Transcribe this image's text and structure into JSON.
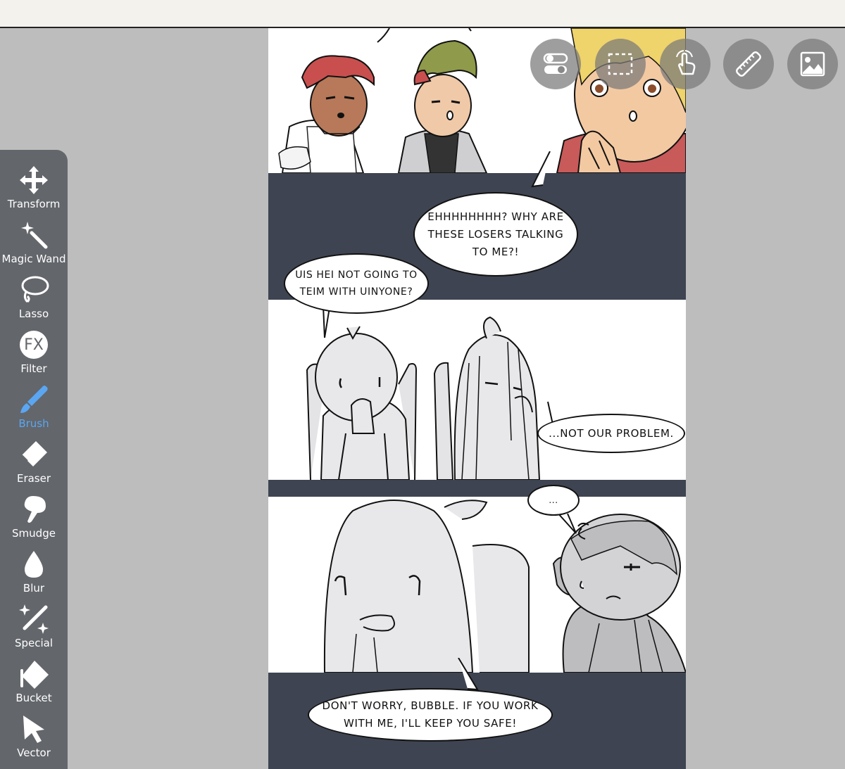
{
  "toolbar": {
    "tools": [
      {
        "label": "Transform",
        "icon": "move-arrows-icon"
      },
      {
        "label": "Magic Wand",
        "icon": "magic-wand-icon"
      },
      {
        "label": "Lasso",
        "icon": "lasso-icon"
      },
      {
        "label": "Filter",
        "icon": "fx-icon"
      },
      {
        "label": "Brush",
        "icon": "brush-icon",
        "active": true
      },
      {
        "label": "Eraser",
        "icon": "eraser-icon"
      },
      {
        "label": "Smudge",
        "icon": "smudge-icon"
      },
      {
        "label": "Blur",
        "icon": "blur-drop-icon"
      },
      {
        "label": "Special",
        "icon": "special-sparkle-icon"
      },
      {
        "label": "Bucket",
        "icon": "bucket-icon"
      },
      {
        "label": "Vector",
        "icon": "vector-arrow-icon"
      }
    ],
    "filter_glyph": "FX",
    "active_color": "#5aa6f2"
  },
  "top_buttons": [
    {
      "icon": "toggle-switches-icon"
    },
    {
      "icon": "selection-marquee-icon"
    },
    {
      "icon": "touch-hand-icon"
    },
    {
      "icon": "ruler-icon"
    },
    {
      "icon": "image-layer-icon"
    }
  ],
  "comic": {
    "bubbles": [
      "EHHHHHHHH? WHY ARE\nTHESE LOSERS TALKING\nTO ME?!",
      "UIS HEI NOT GOING TO\nTEIM WITH UINYONE?",
      "...NOT OUR PROBLEM.",
      "...",
      "DON'T WORRY, BUBBLE. IF YOU WORK\nWITH ME, I'LL KEEP YOU SAFE!"
    ],
    "panel_dark_color": "#3e4451"
  }
}
